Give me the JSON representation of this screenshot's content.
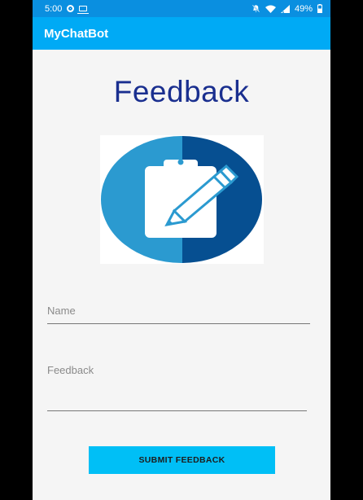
{
  "status_bar": {
    "time": "5:00",
    "battery": "49%",
    "icons": [
      "record-icon",
      "cast-icon",
      "do-not-disturb-icon",
      "wifi-icon",
      "signal-icon",
      "battery-icon"
    ]
  },
  "app_bar": {
    "title": "MyChatBot"
  },
  "main": {
    "title": "Feedback",
    "logo_icon": "clipboard-pencil-icon",
    "name_field": {
      "placeholder": "Name",
      "value": ""
    },
    "feedback_field": {
      "placeholder": "Feedback",
      "value": ""
    },
    "submit_label": "SUBMIT FEEDBACK"
  },
  "colors": {
    "status_bar": "#0a8fe0",
    "app_bar": "#00aaf5",
    "title": "#1a2f8f",
    "button": "#00bff6",
    "logo_light": "#2b9ad0",
    "logo_dark": "#064f91"
  }
}
